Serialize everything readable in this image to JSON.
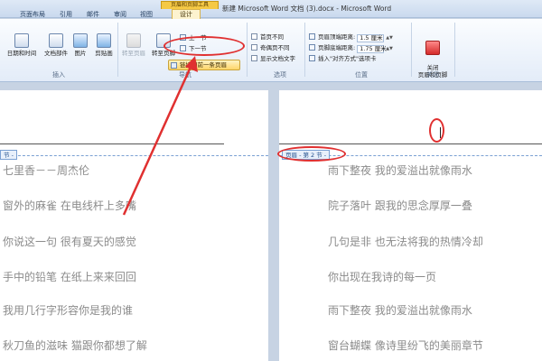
{
  "window": {
    "context_group": "页眉和页脚工具",
    "title": "新建 Microsoft Word 文档 (3).docx - Microsoft Word"
  },
  "tabs": [
    "页面布局",
    "引用",
    "邮件",
    "审阅",
    "视图",
    "设计"
  ],
  "active_tab": "设计",
  "ribbon": {
    "insert_group": {
      "label": "插入",
      "buttons": [
        "日期和时间",
        "文档部件",
        "图片",
        "剪贴画"
      ]
    },
    "nav_group": {
      "label": "导航",
      "buttons": [
        "转至页眉",
        "转至页脚"
      ],
      "prev_section": "上一节",
      "next_section": "下一节",
      "link_to_previous": "链接到前一条页眉"
    },
    "options_group": {
      "label": "选项",
      "items": [
        "首页不同",
        "奇偶页不同",
        "显示文档文字"
      ]
    },
    "position_group": {
      "label": "位置",
      "header_top_label": "页眉顶端距离:",
      "header_top_value": "1.5 厘米",
      "footer_bottom_label": "页脚底端距离:",
      "footer_bottom_value": "1.75 厘米",
      "insert_align_tab": "插入\"对齐方式\"选项卡"
    },
    "close_group": {
      "label": "关闭",
      "button": "关闭\n页眉和页脚"
    }
  },
  "document": {
    "left_tag": "节 -",
    "right_tag": "页眉 - 第 2 节 -",
    "left_lines": [
      "七里香－－周杰伦",
      "窗外的麻雀 在电线杆上多嘴",
      "你说这一句 很有夏天的感觉",
      "手中的铅笔 在纸上来来回回",
      "我用几行字形容你是我的谁",
      "秋刀鱼的滋味 猫跟你都想了解"
    ],
    "right_lines": [
      "雨下整夜 我的爱溢出就像雨水",
      "院子落叶 跟我的思念厚厚一叠",
      "几句是非 也无法将我的热情冷却",
      "你出现在我诗的每一页",
      "雨下整夜 我的爱溢出就像雨水",
      "窗台蝴蝶 像诗里纷飞的美丽章节"
    ]
  },
  "colors": {
    "annotation": "#e03030",
    "ribbon_bg": "#e3ecf8",
    "active_tab": "#fdf3cf"
  }
}
